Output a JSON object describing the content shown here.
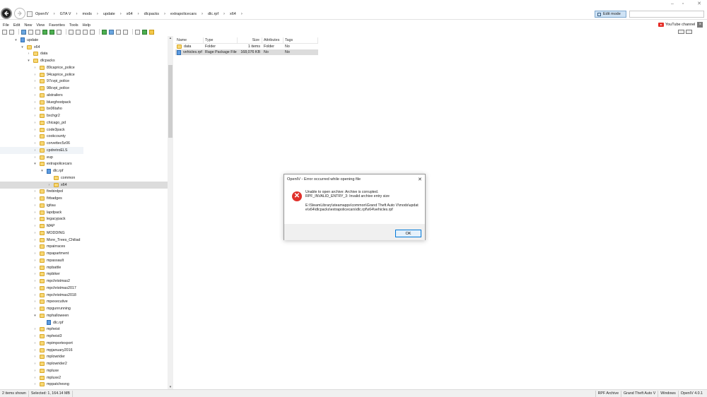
{
  "address": {
    "crumbs": [
      "OpenIV",
      "GTA V",
      "mods",
      "update",
      "x64",
      "dlcpacks",
      "extrapolicecars",
      "dlc.rpf",
      "x64"
    ],
    "edit_mode_label": "Edit mode"
  },
  "menu": [
    "File",
    "Edit",
    "New",
    "View",
    "Favorites",
    "Tools",
    "Help"
  ],
  "youtube": {
    "label": "YouTube channel",
    "close": "×"
  },
  "tree": [
    {
      "label": "update",
      "twisty": "▾",
      "icon": "rpf",
      "indent": 0
    },
    {
      "label": "x64",
      "twisty": "▾",
      "icon": "folder",
      "indent": 1
    },
    {
      "label": "data",
      "twisty": "›",
      "icon": "folder",
      "indent": 2
    },
    {
      "label": "dlcpacks",
      "twisty": "▾",
      "icon": "folder",
      "indent": 2
    },
    {
      "label": "89caprice_police",
      "twisty": "›",
      "icon": "folder",
      "indent": 3
    },
    {
      "label": "94caprice_police",
      "twisty": "›",
      "icon": "folder",
      "indent": 3
    },
    {
      "label": "97cvpi_police",
      "twisty": "›",
      "icon": "folder",
      "indent": 3
    },
    {
      "label": "98cvpi_police",
      "twisty": "›",
      "icon": "folder",
      "indent": 3
    },
    {
      "label": "alstrailers",
      "twisty": "›",
      "icon": "folder",
      "indent": 3
    },
    {
      "label": "blueghostpack",
      "twisty": "›",
      "icon": "folder",
      "indent": 3
    },
    {
      "label": "bx06taho",
      "twisty": "›",
      "icon": "folder",
      "indent": 3
    },
    {
      "label": "bxchgr2",
      "twisty": "›",
      "icon": "folder",
      "indent": 3
    },
    {
      "label": "chicago_pd",
      "twisty": "›",
      "icon": "folder",
      "indent": 3
    },
    {
      "label": "code3pack",
      "twisty": "›",
      "icon": "folder",
      "indent": 3
    },
    {
      "label": "cookcounty",
      "twisty": "›",
      "icon": "folder",
      "indent": 3
    },
    {
      "label": "corvettec5z06",
      "twisty": "›",
      "icon": "folder",
      "indent": 3
    },
    {
      "label": "cpdretroELS",
      "twisty": "›",
      "icon": "folder",
      "indent": 3,
      "hover": true
    },
    {
      "label": "eup",
      "twisty": "›",
      "icon": "folder",
      "indent": 3
    },
    {
      "label": "extrapolicecars",
      "twisty": "▾",
      "icon": "folder",
      "indent": 3
    },
    {
      "label": "dlc.rpf",
      "twisty": "▾",
      "icon": "rpf",
      "indent": 4
    },
    {
      "label": "common",
      "twisty": "",
      "icon": "folder",
      "indent": 5
    },
    {
      "label": "x64",
      "twisty": "›",
      "icon": "folder",
      "indent": 5,
      "selected": true
    },
    {
      "label": "firebirdpol",
      "twisty": "›",
      "icon": "folder",
      "indent": 3
    },
    {
      "label": "firbadges",
      "twisty": "›",
      "icon": "folder",
      "indent": 3
    },
    {
      "label": "igitau",
      "twisty": "›",
      "icon": "folder",
      "indent": 3
    },
    {
      "label": "lapdpack",
      "twisty": "›",
      "icon": "folder",
      "indent": 3
    },
    {
      "label": "legacypack",
      "twisty": "›",
      "icon": "folder",
      "indent": 3
    },
    {
      "label": "MAP",
      "twisty": "›",
      "icon": "folder",
      "indent": 3
    },
    {
      "label": "MODDING",
      "twisty": "›",
      "icon": "folder",
      "indent": 3
    },
    {
      "label": "More_Trees_Chiliad",
      "twisty": "›",
      "icon": "folder",
      "indent": 3
    },
    {
      "label": "mpairraces",
      "twisty": "›",
      "icon": "folder",
      "indent": 3
    },
    {
      "label": "mpapartment",
      "twisty": "›",
      "icon": "folder",
      "indent": 3
    },
    {
      "label": "mpassault",
      "twisty": "›",
      "icon": "folder",
      "indent": 3
    },
    {
      "label": "mpbattle",
      "twisty": "›",
      "icon": "folder",
      "indent": 3
    },
    {
      "label": "mpbiker",
      "twisty": "›",
      "icon": "folder",
      "indent": 3
    },
    {
      "label": "mpchristmas2",
      "twisty": "›",
      "icon": "folder",
      "indent": 3
    },
    {
      "label": "mpchristmas2017",
      "twisty": "›",
      "icon": "folder",
      "indent": 3
    },
    {
      "label": "mpchristmas2018",
      "twisty": "›",
      "icon": "folder",
      "indent": 3
    },
    {
      "label": "mpexecutive",
      "twisty": "›",
      "icon": "folder",
      "indent": 3
    },
    {
      "label": "mpgunrunning",
      "twisty": "›",
      "icon": "folder",
      "indent": 3
    },
    {
      "label": "mphalloween",
      "twisty": "▾",
      "icon": "folder",
      "indent": 3
    },
    {
      "label": "dlc.rpf",
      "twisty": "",
      "icon": "rpf",
      "indent": 4
    },
    {
      "label": "mpheist",
      "twisty": "›",
      "icon": "folder",
      "indent": 3
    },
    {
      "label": "mpheist3",
      "twisty": "›",
      "icon": "folder",
      "indent": 3
    },
    {
      "label": "mpimportexport",
      "twisty": "›",
      "icon": "folder",
      "indent": 3
    },
    {
      "label": "mpjanuary2016",
      "twisty": "›",
      "icon": "folder",
      "indent": 3
    },
    {
      "label": "mplowrider",
      "twisty": "›",
      "icon": "folder",
      "indent": 3
    },
    {
      "label": "mplowrider2",
      "twisty": "›",
      "icon": "folder",
      "indent": 3
    },
    {
      "label": "mpluxe",
      "twisty": "›",
      "icon": "folder",
      "indent": 3
    },
    {
      "label": "mpluxe2",
      "twisty": "›",
      "icon": "folder",
      "indent": 3
    },
    {
      "label": "mppatchesng",
      "twisty": "›",
      "icon": "folder",
      "indent": 3
    }
  ],
  "filelist": {
    "columns": [
      "Name",
      "Type",
      "Size",
      "Attributes",
      "Tags"
    ],
    "rows": [
      {
        "name": "data",
        "type": "Folder",
        "size": "1 items",
        "attributes": "Folder",
        "tags": "No",
        "icon": "folder",
        "selected": false
      },
      {
        "name": "vehicles.rpf",
        "type": "Rage Package File",
        "size": "168,076 KB",
        "attributes": "No",
        "tags": "No",
        "icon": "rpf",
        "selected": true
      }
    ]
  },
  "dialog": {
    "title": "OpenIV - Error occurred while opening file",
    "close": "✕",
    "message_line1": "Unable to open archive: Archive is corrupted.",
    "message_line2": "RPF_INVALID_ENTRY_3: Invalid archive entry size",
    "path": "E:\\SteamLibrary\\steamapps\\common\\Grand Theft Auto V\\mods\\update\\x64\\dlcpacks\\extrapolicecars\\dlc.rpf\\x64\\vehicles.rpf",
    "ok_label": "OK"
  },
  "statusbar": {
    "items_shown": "2 items shown",
    "selected": "Selected: 1,  164.14 MB",
    "right": [
      "RPF Archive",
      "Grand Theft Auto V",
      "Windows",
      "OpenIV 4.0.1"
    ]
  }
}
